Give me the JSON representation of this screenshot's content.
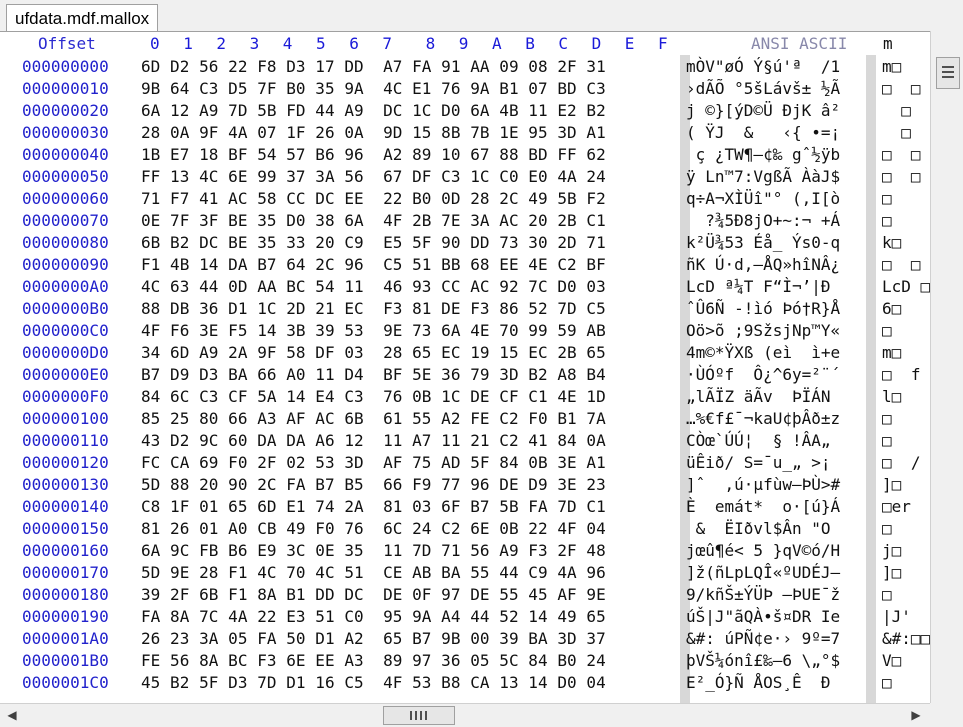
{
  "tab": {
    "title": "ufdata.mdf.mallox"
  },
  "header": {
    "offset_label": "Offset",
    "columns": [
      "0",
      "1",
      "2",
      "3",
      "4",
      "5",
      "6",
      "7",
      "8",
      "9",
      "A",
      "B",
      "C",
      "D",
      "E",
      "F"
    ],
    "ascii_label": "ANSI ASCII",
    "ascii_label2": "m"
  },
  "rows": [
    {
      "addr": "000000000",
      "bytes": "6D D2 56 22 F8 D3 17 DD  A7 FA 91 AA 09 08 2F 31",
      "ansi": "mÒV\"øÓ Ý§ú'ª  /1",
      "ascii": "m□"
    },
    {
      "addr": "000000010",
      "bytes": "9B 64 C3 D5 7F B0 35 9A  4C E1 76 9A B1 07 BD C3",
      "ansi": "›dÃÕ °5šLávš± ½Ã",
      "ascii": "□  □"
    },
    {
      "addr": "000000020",
      "bytes": "6A 12 A9 7D 5B FD 44 A9  DC 1C D0 6A 4B 11 E2 B2",
      "ansi": "j ©}[ýD©Ü ÐjK â²",
      "ascii": "  □"
    },
    {
      "addr": "000000030",
      "bytes": "28 0A 9F 4A 07 1F 26 0A  9D 15 8B 7B 1E 95 3D A1",
      "ansi": "( ŸJ  &   ‹{ •=¡",
      "ascii": "  □"
    },
    {
      "addr": "000000040",
      "bytes": "1B E7 18 BF 54 57 B6 96  A2 89 10 67 88 BD FF 62",
      "ansi": " ç ¿TW¶–¢‰ gˆ½ÿb",
      "ascii": "□  □"
    },
    {
      "addr": "000000050",
      "bytes": "FF 13 4C 6E 99 37 3A 56  67 DF C3 1C C0 E0 4A 24",
      "ansi": "ÿ Ln™7:VgßÃ ÀàJ$",
      "ascii": "□  □"
    },
    {
      "addr": "000000060",
      "bytes": "71 F7 41 AC 58 CC DC EE  22 B0 0D 28 2C 49 5B F2",
      "ansi": "q÷A¬XÌÜî\"° (,I[ò",
      "ascii": "□"
    },
    {
      "addr": "000000070",
      "bytes": "0E 7F 3F BE 35 D0 38 6A  4F 2B 7E 3A AC 20 2B C1",
      "ansi": "  ?¾5Ð8jO+~:¬ +Á",
      "ascii": "□"
    },
    {
      "addr": "000000080",
      "bytes": "6B B2 DC BE 35 33 20 C9  E5 5F 90 DD 73 30 2D 71",
      "ansi": "k²Ü¾53 Éå_ Ýs0-q",
      "ascii": "k□"
    },
    {
      "addr": "000000090",
      "bytes": "F1 4B 14 DA B7 64 2C 96  C5 51 BB 68 EE 4E C2 BF",
      "ansi": "ñK Ú·d,–ÅQ»hîNÂ¿",
      "ascii": "□  □"
    },
    {
      "addr": "0000000A0",
      "bytes": "4C 63 44 0D AA BC 54 11  46 93 CC AC 92 7C D0 03",
      "ansi": "LcD ª¼T F“Ì¬’|Ð ",
      "ascii": "LcD □"
    },
    {
      "addr": "0000000B0",
      "bytes": "88 DB 36 D1 1C 2D 21 EC  F3 81 DE F3 86 52 7D C5",
      "ansi": "ˆÛ6Ñ -!ìó Þó†R}Å",
      "ascii": "6□"
    },
    {
      "addr": "0000000C0",
      "bytes": "4F F6 3E F5 14 3B 39 53  9E 73 6A 4E 70 99 59 AB",
      "ansi": "Oö>õ ;9SžsjNp™Y«",
      "ascii": "□"
    },
    {
      "addr": "0000000D0",
      "bytes": "34 6D A9 2A 9F 58 DF 03  28 65 EC 19 15 EC 2B 65",
      "ansi": "4m©*ŸXß (eì  ì+e",
      "ascii": "m□"
    },
    {
      "addr": "0000000E0",
      "bytes": "B7 D9 D3 BA 66 A0 11 D4  BF 5E 36 79 3D B2 A8 B4",
      "ansi": "·ÙÓºf  Ô¿^6y=²¨´",
      "ascii": "□  f"
    },
    {
      "addr": "0000000F0",
      "bytes": "84 6C C3 CF 5A 14 E4 C3  76 0B 1C DE CF C1 4E 1D",
      "ansi": "„lÃÏZ äÃv  ÞÏÁN ",
      "ascii": "l□"
    },
    {
      "addr": "000000100",
      "bytes": "85 25 80 66 A3 AF AC 6B  61 55 A2 FE C2 F0 B1 7A",
      "ansi": "…%€f£¯¬kaU¢þÂð±z",
      "ascii": "□"
    },
    {
      "addr": "000000110",
      "bytes": "43 D2 9C 60 DA DA A6 12  11 A7 11 21 C2 41 84 0A",
      "ansi": "CÒœ`ÚÚ¦  § !ÂA„ ",
      "ascii": "□"
    },
    {
      "addr": "000000120",
      "bytes": "FC CA 69 F0 2F 02 53 3D  AF 75 AD 5F 84 0B 3E A1",
      "ansi": "üÊið/ S=¯u­_„ >¡",
      "ascii": "□  /"
    },
    {
      "addr": "000000130",
      "bytes": "5D 88 20 90 2C FA B7 B5  66 F9 77 96 DE D9 3E 23",
      "ansi": "]ˆ  ,ú·µfùw–ÞÙ>#",
      "ascii": "]□"
    },
    {
      "addr": "000000140",
      "bytes": "C8 1F 01 65 6D E1 74 2A  81 03 6F B7 5B FA 7D C1",
      "ansi": "È  emát*  o·[ú}Á",
      "ascii": "□er"
    },
    {
      "addr": "000000150",
      "bytes": "81 26 01 A0 CB 49 F0 76  6C 24 C2 6E 0B 22 4F 04",
      "ansi": " &  ËIðvl$Ân \"O ",
      "ascii": "□"
    },
    {
      "addr": "000000160",
      "bytes": "6A 9C FB B6 E9 3C 0E 35  11 7D 71 56 A9 F3 2F 48",
      "ansi": "jœû¶é< 5 }qV©ó/H",
      "ascii": "j□"
    },
    {
      "addr": "000000170",
      "bytes": "5D 9E 28 F1 4C 70 4C 51  CE AB BA 55 44 C9 4A 96",
      "ansi": "]ž(ñLpLQÎ«ºUDÉJ–",
      "ascii": "]□"
    },
    {
      "addr": "000000180",
      "bytes": "39 2F 6B F1 8A B1 DD DC  DE 0F 97 DE 55 45 AF 9E",
      "ansi": "9/kñŠ±ÝÜÞ —ÞUE¯ž",
      "ascii": "□"
    },
    {
      "addr": "000000190",
      "bytes": "FA 8A 7C 4A 22 E3 51 C0  95 9A A4 44 52 14 49 65",
      "ansi": "úŠ|J\"ãQÀ•š¤DR Ie",
      "ascii": "|J'"
    },
    {
      "addr": "0000001A0",
      "bytes": "26 23 3A 05 FA 50 D1 A2  65 B7 9B 00 39 BA 3D 37",
      "ansi": "&#: úPÑ¢e·› 9º=7",
      "ascii": "&#:□□"
    },
    {
      "addr": "0000001B0",
      "bytes": "FE 56 8A BC F3 6E EE A3  89 97 36 05 5C 84 B0 24",
      "ansi": "þVŠ¼ónî£‰—6 \\„°$",
      "ascii": "V□"
    },
    {
      "addr": "0000001C0",
      "bytes": "45 B2 5F D3 7D D1 16 C5  4F 53 B8 CA 13 14 D0 04",
      "ansi": "E²_Ó}Ñ ÅOS¸Ê  Ð ",
      "ascii": "□"
    }
  ],
  "scrollbars": {
    "vertical_thumb_icon": "grip-lines",
    "horizontal_thumb_icon": "grip-lines"
  }
}
